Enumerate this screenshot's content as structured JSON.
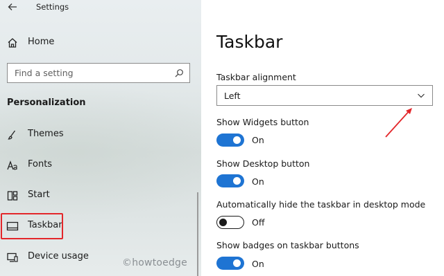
{
  "window": {
    "title": "Settings"
  },
  "sidebar": {
    "home_label": "Home",
    "search_placeholder": "Find a setting",
    "section_heading": "Personalization",
    "items": [
      {
        "label": "Themes",
        "icon": "brush-icon"
      },
      {
        "label": "Fonts",
        "icon": "fonts-icon"
      },
      {
        "label": "Start",
        "icon": "start-icon"
      },
      {
        "label": "Taskbar",
        "icon": "taskbar-icon",
        "selected": true
      },
      {
        "label": "Device usage",
        "icon": "device-usage-icon"
      }
    ]
  },
  "main": {
    "title": "Taskbar",
    "alignment": {
      "label": "Taskbar alignment",
      "value": "Left"
    },
    "settings": [
      {
        "label": "Show Widgets button",
        "state": "On"
      },
      {
        "label": "Show Desktop button",
        "state": "On"
      },
      {
        "label": "Automatically hide the taskbar in desktop mode",
        "state": "Off"
      },
      {
        "label": "Show badges on taskbar buttons",
        "state": "On"
      }
    ]
  },
  "watermark": "©howtoedge",
  "colors": {
    "accent": "#1e74d3",
    "highlight": "#e3262a"
  }
}
